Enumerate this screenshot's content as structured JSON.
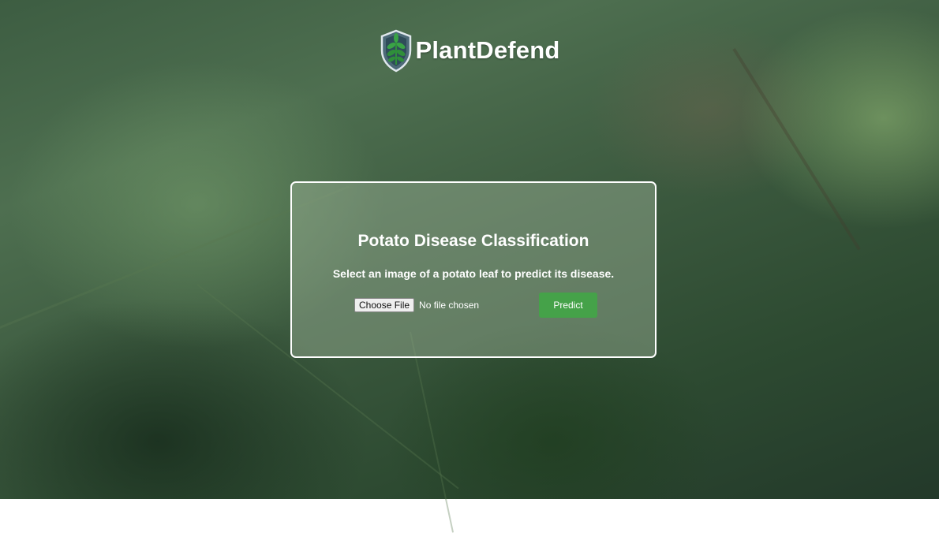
{
  "app": {
    "brand_name": "PlantDefend",
    "logo_icon": "shield-plant-icon"
  },
  "card": {
    "title": "Potato Disease Classification",
    "subtitle": "Select an image of a potato leaf to predict its disease.",
    "file_input": {
      "button_label": "Choose File",
      "status_text": "No file chosen"
    },
    "predict_label": "Predict"
  },
  "colors": {
    "predict_button": "#45a249",
    "card_border": "#ffffff",
    "text": "#ffffff"
  }
}
